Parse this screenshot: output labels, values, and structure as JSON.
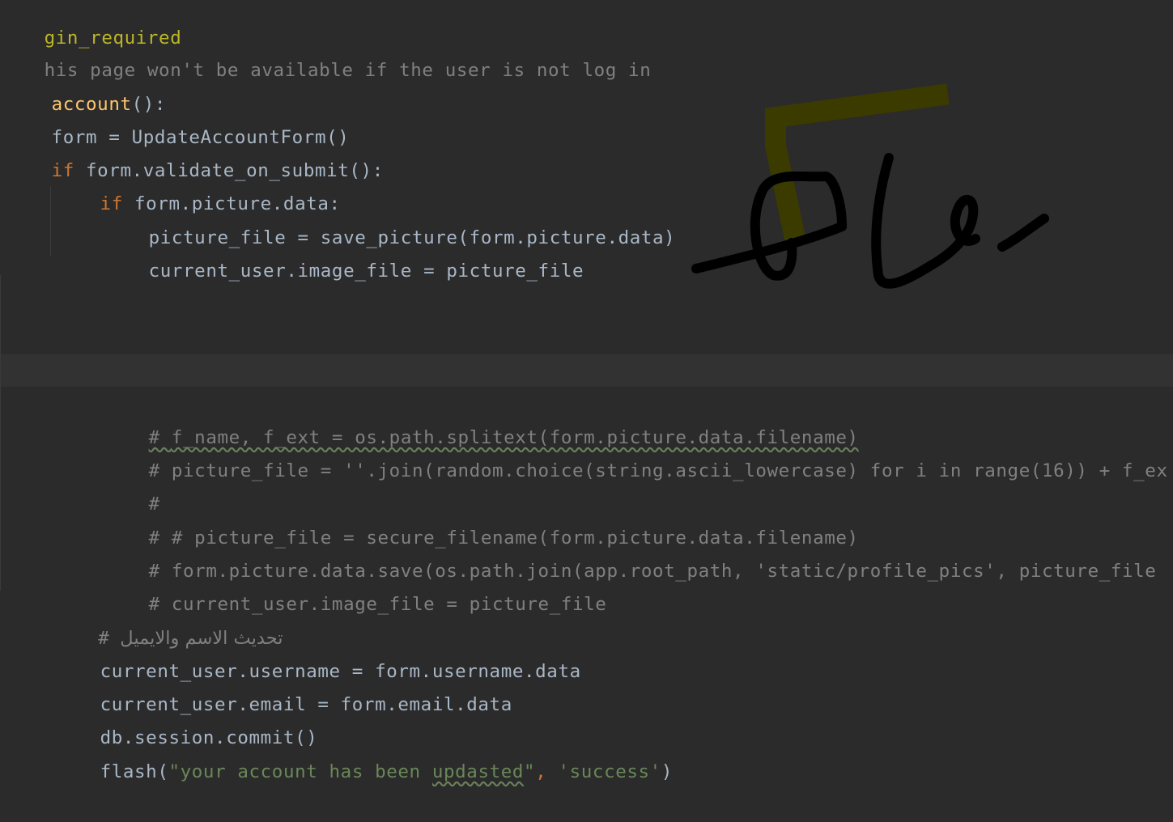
{
  "editor": {
    "lines": {
      "decorator": "gin_required",
      "comment_login": "his page won't be available if the user is not log in",
      "def_name": "account",
      "def_tail": "():",
      "form_assign": "form = UpdateAccountForm()",
      "if_kw1": "if",
      "if_cond1": " form.validate_on_submit():",
      "if_kw2": "if",
      "if_cond2": " form.picture.data:",
      "save_picture": "picture_file = save_picture(form.picture.data)",
      "set_image": "current_user.image_file = picture_file",
      "c1_hash": "# ",
      "c1_text": "f_name, f_ext = os.path.splitext(form.picture.data.filename)",
      "c2": "# picture_file = ''.join(random.choice(string.ascii_lowercase) for i in range(16)) + f_ex",
      "c3": "#",
      "c4": "# # picture_file = secure_filename(form.picture.data.filename)",
      "c5": "# form.picture.data.save(os.path.join(app.root_path, 'static/profile_pics', picture_file",
      "c6": "# current_user.image_file = picture_file",
      "c7_hash": "# ",
      "c7_arabic": "تحديث الاسم والايميل",
      "set_username": "current_user.username = form.username.data",
      "set_email": "current_user.email = form.email.data",
      "commit": "db.session.commit()",
      "flash_fn": "flash(",
      "flash_str1_a": "\"your account has been ",
      "flash_str1_typo": "updasted",
      "flash_str1_b": "\"",
      "flash_comma": ", ",
      "flash_str2": "'success'",
      "flash_close": ")"
    }
  },
  "colors": {
    "background": "#2b2b2b",
    "text": "#a9b7c6",
    "keyword": "#cc7832",
    "decorator": "#bbb529",
    "function": "#ffc66d",
    "comment": "#808080",
    "string": "#6a8759",
    "ink_black": "#000000",
    "ink_olive": "#3b3b00"
  }
}
